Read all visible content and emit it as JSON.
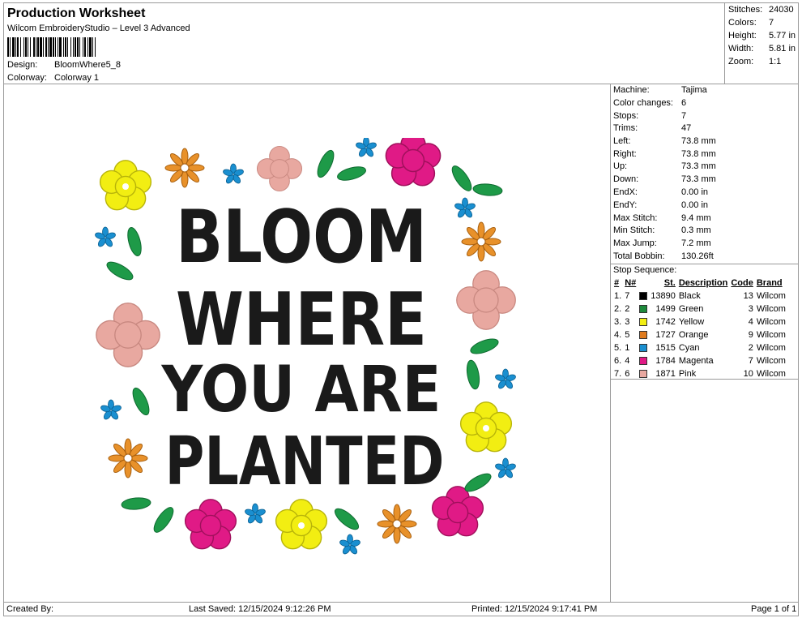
{
  "header": {
    "title": "Production Worksheet",
    "software": "Wilcom EmbroideryStudio – Level 3 Advanced",
    "design_label": "Design:",
    "design_value": "BloomWhere5_8",
    "colorway_label": "Colorway:",
    "colorway_value": "Colorway 1"
  },
  "summary": {
    "stitches_label": "Stitches:",
    "stitches_value": "24030",
    "colors_label": "Colors:",
    "colors_value": "7",
    "height_label": "Height:",
    "height_value": "5.77 in",
    "width_label": "Width:",
    "width_value": "5.81 in",
    "zoom_label": "Zoom:",
    "zoom_value": "1:1"
  },
  "machine": {
    "rows": [
      {
        "label": "Machine:",
        "value": "Tajima"
      },
      {
        "label": "Color changes:",
        "value": "6"
      },
      {
        "label": "Stops:",
        "value": "7"
      },
      {
        "label": "Trims:",
        "value": "47"
      },
      {
        "label": "Left:",
        "value": "73.8 mm"
      },
      {
        "label": "Right:",
        "value": "73.8 mm"
      },
      {
        "label": "Up:",
        "value": "73.3 mm"
      },
      {
        "label": "Down:",
        "value": "73.3 mm"
      },
      {
        "label": "EndX:",
        "value": "0.00 in"
      },
      {
        "label": "EndY:",
        "value": "0.00 in"
      },
      {
        "label": "Max Stitch:",
        "value": "9.4 mm"
      },
      {
        "label": "Min Stitch:",
        "value": "0.3 mm"
      },
      {
        "label": "Max Jump:",
        "value": "7.2 mm"
      },
      {
        "label": "Total Bobbin:",
        "value": "130.26ft"
      }
    ]
  },
  "stop_sequence": {
    "title": "Stop Sequence:",
    "headers": {
      "idx": "#",
      "n": "N#",
      "st": "St.",
      "desc": "Description",
      "code": "Code",
      "brand": "Brand"
    },
    "rows": [
      {
        "idx": "1.",
        "n": "7",
        "color": "#000000",
        "st": "13890",
        "desc": "Black",
        "code": "13",
        "brand": "Wilcom"
      },
      {
        "idx": "2.",
        "n": "2",
        "color": "#1e8a3c",
        "st": "1499",
        "desc": "Green",
        "code": "3",
        "brand": "Wilcom"
      },
      {
        "idx": "3.",
        "n": "3",
        "color": "#f2ee12",
        "st": "1742",
        "desc": "Yellow",
        "code": "4",
        "brand": "Wilcom"
      },
      {
        "idx": "4.",
        "n": "5",
        "color": "#e07b1e",
        "st": "1727",
        "desc": "Orange",
        "code": "9",
        "brand": "Wilcom"
      },
      {
        "idx": "5.",
        "n": "1",
        "color": "#1a8fd0",
        "st": "1515",
        "desc": "Cyan",
        "code": "2",
        "brand": "Wilcom"
      },
      {
        "idx": "6.",
        "n": "4",
        "color": "#e01a86",
        "st": "1784",
        "desc": "Magenta",
        "code": "7",
        "brand": "Wilcom"
      },
      {
        "idx": "7.",
        "n": "6",
        "color": "#e8a8a0",
        "st": "1871",
        "desc": "Pink",
        "code": "10",
        "brand": "Wilcom"
      }
    ]
  },
  "design_text": [
    "BLOOM",
    "WHERE",
    "YOU ARE",
    "PLANTED"
  ],
  "footer": {
    "created": "Created By:",
    "saved": "Last Saved: 12/15/2024 9:12:26 PM",
    "printed": "Printed: 12/15/2024 9:17:41 PM",
    "page": "Page 1 of 1"
  }
}
